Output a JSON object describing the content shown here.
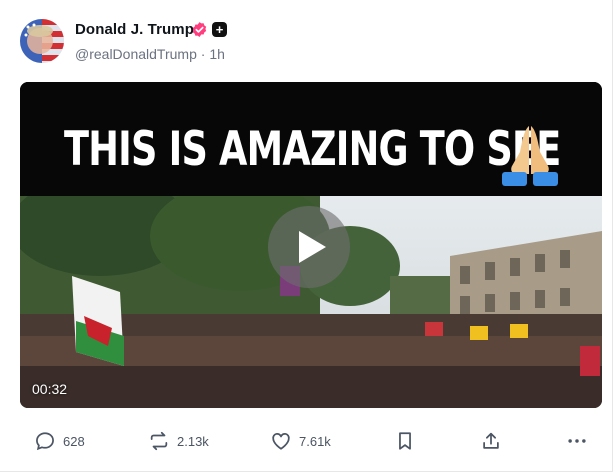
{
  "post": {
    "author_name": "Donald J. Trump",
    "handle": "@realDonaldTrump",
    "separator": "·",
    "time": "1h",
    "badges": [
      "verified-check-icon",
      "plus-icon"
    ]
  },
  "video": {
    "banner_text": "THIS IS AMAZING TO SEE",
    "banner_emoji": "praying-hands",
    "duration": "00:32",
    "play_icon": "play-icon"
  },
  "actions": {
    "replies": "628",
    "reposts": "2.13k",
    "likes": "7.61k",
    "bookmark_icon": "bookmark-icon",
    "share_icon": "share-icon",
    "more_icon": "more-icon"
  },
  "colors": {
    "verified": "#ff3d7f",
    "banner_bg": "#070707",
    "muted_text": "#6b7280"
  }
}
